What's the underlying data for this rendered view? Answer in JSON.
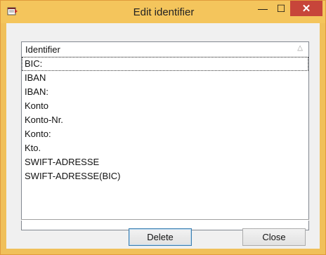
{
  "window": {
    "title": "Edit identifier",
    "app_icon": "notes-icon",
    "controls": {
      "minimize": "—",
      "maximize": "☐",
      "close": "✕"
    }
  },
  "list": {
    "column_header": "Identifier",
    "sort_indicator": "△",
    "items": [
      "BIC:",
      "IBAN",
      "IBAN:",
      "Konto",
      "Konto-Nr.",
      "Konto:",
      "Kto.",
      "SWIFT-ADRESSE",
      "SWIFT-ADRESSE(BIC)"
    ],
    "selected_index": 0
  },
  "buttons": {
    "delete_label": "Delete",
    "close_label": "Close"
  },
  "colors": {
    "titlebar": "#f4c55c",
    "close_button": "#c7453a",
    "client_background": "#f0f0f0"
  }
}
